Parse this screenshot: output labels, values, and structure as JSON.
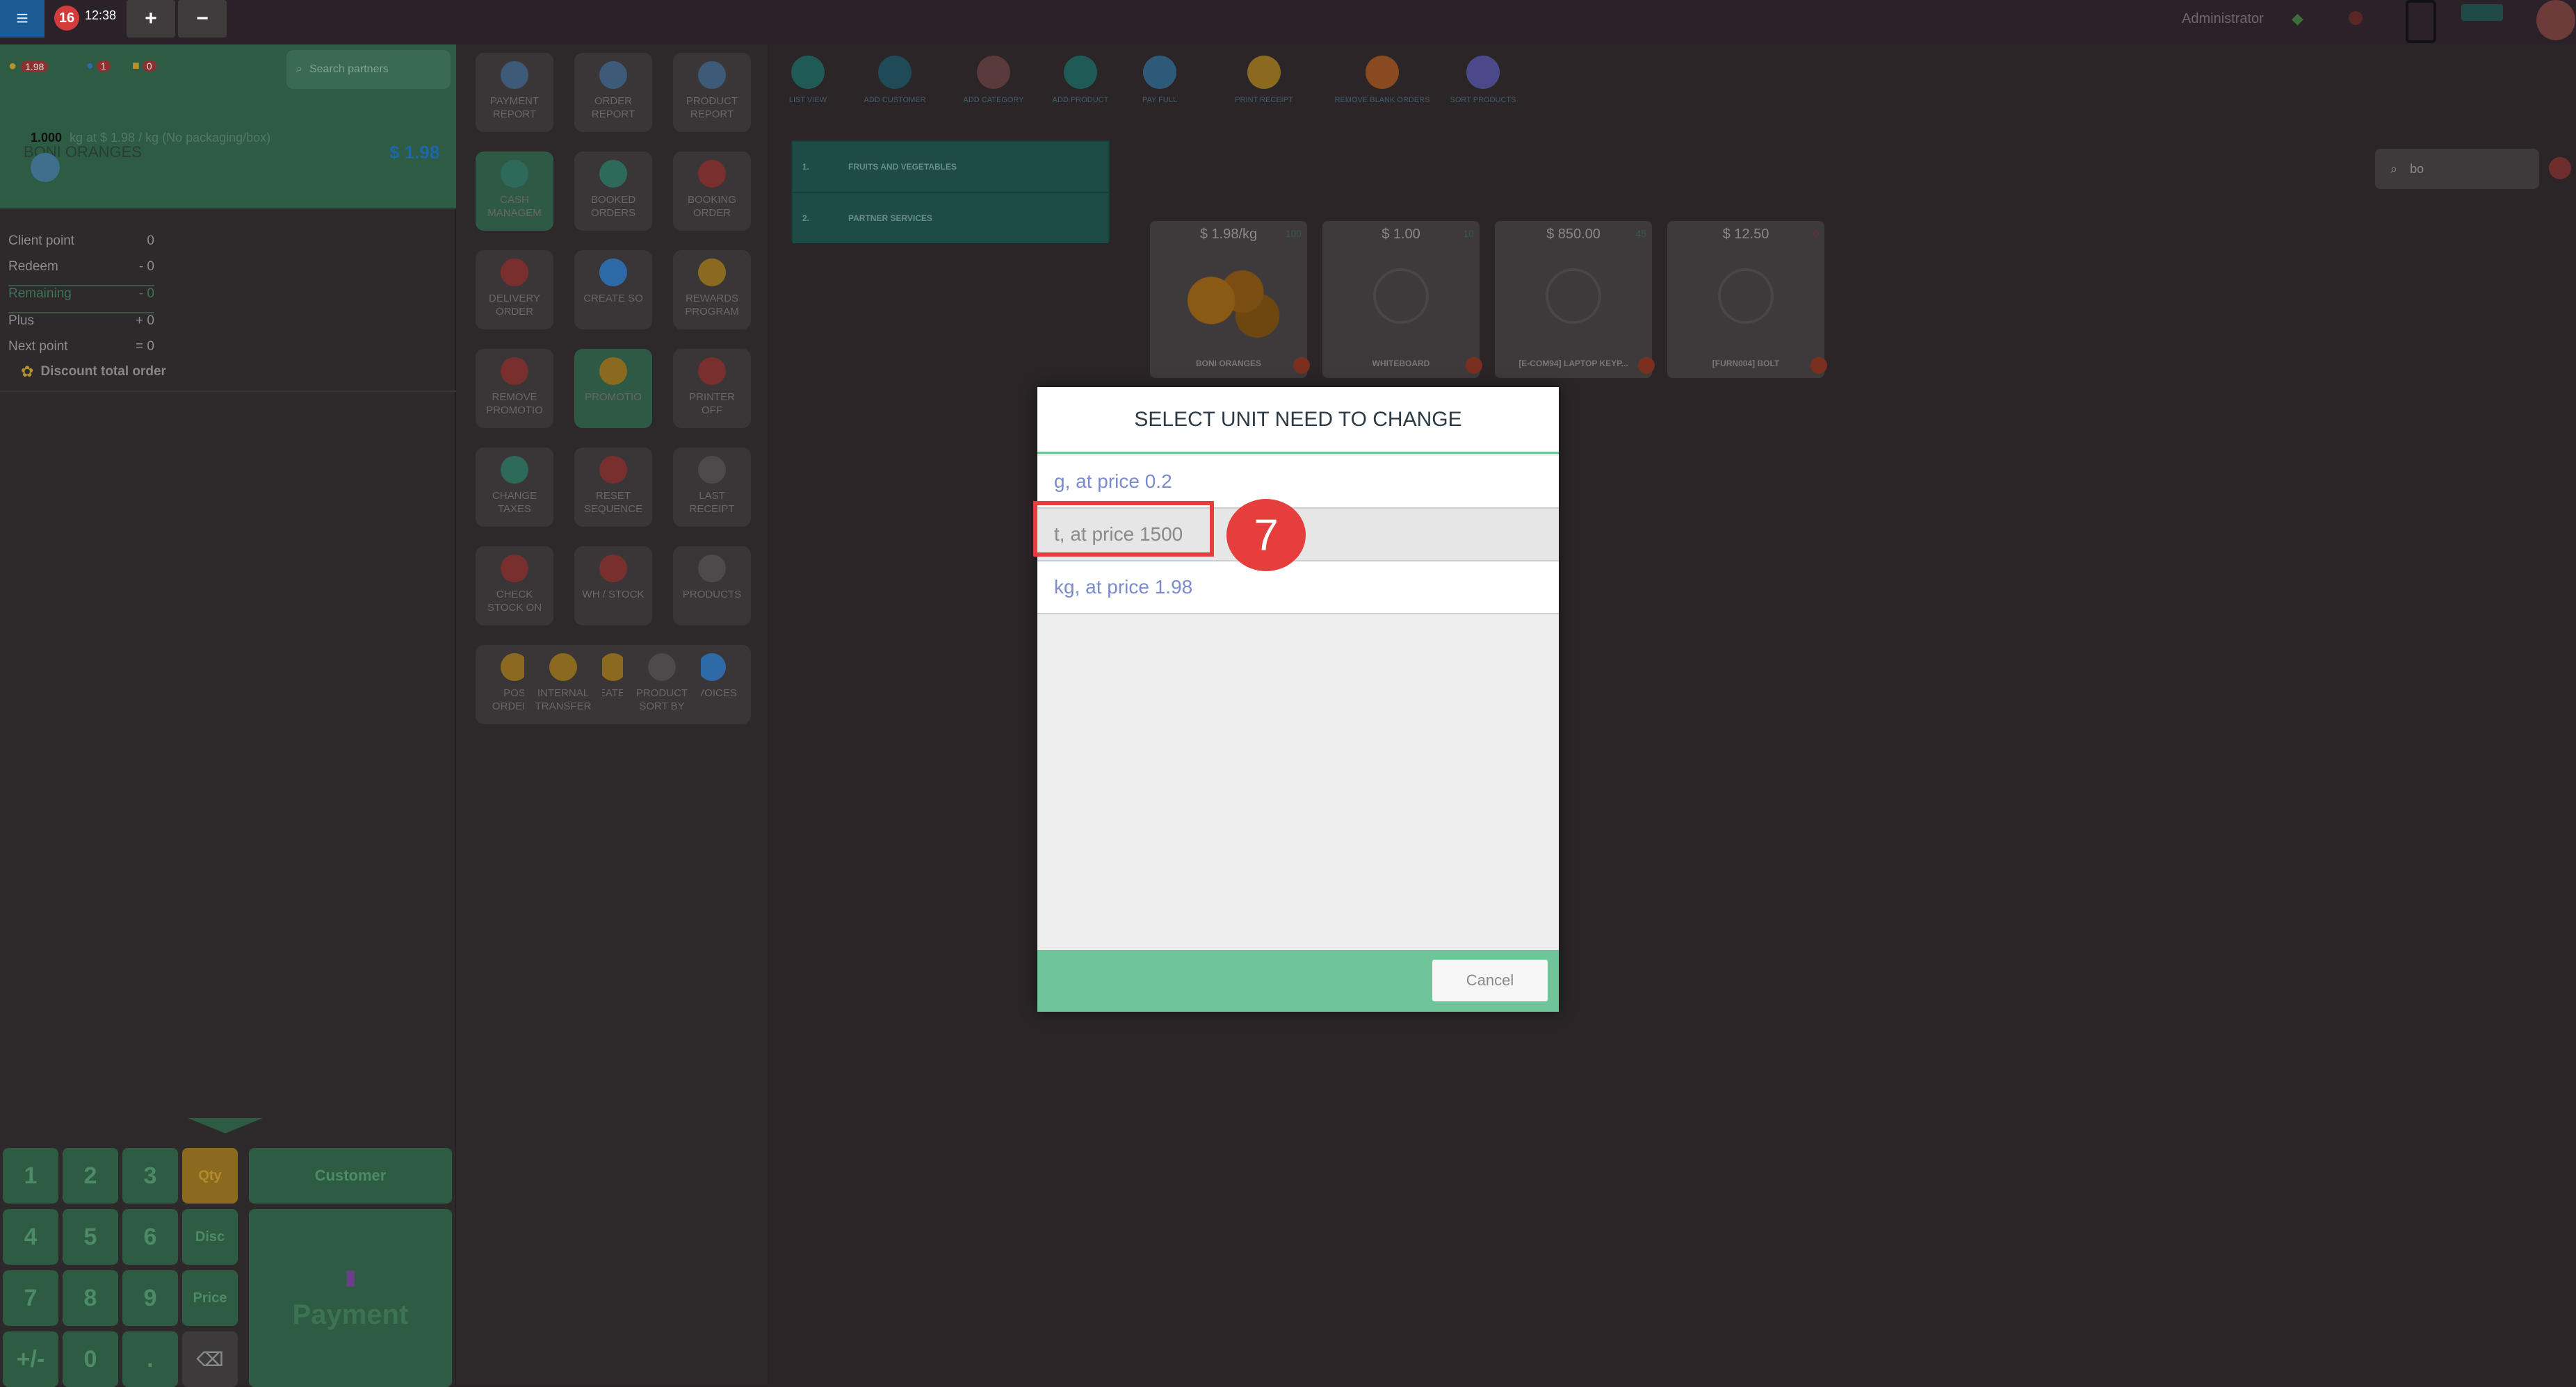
{
  "topbar": {
    "order_count": "16",
    "time": "12:38",
    "plus_label": "+",
    "minus_label": "−",
    "user": "Administrator"
  },
  "order": {
    "badge_amount": "1.98",
    "badge_count_1": "1",
    "badge_count_2": "0",
    "search_placeholder": "Search partners",
    "product_name": "BONI ORANGES",
    "product_total": "$ 1.98",
    "line_qty": "1.000",
    "line_detail": "kg at $ 1.98 / kg (No packaging/box)"
  },
  "points": {
    "rows": [
      {
        "label": "Client point",
        "value": "0"
      },
      {
        "label": "Redeem",
        "value": "- 0"
      },
      {
        "label": "Remaining",
        "value": "- 0"
      },
      {
        "label": "Plus",
        "value": "+ 0"
      },
      {
        "label": "Next point",
        "value": "= 0"
      }
    ],
    "discount_label": "Discount total order"
  },
  "numpad": {
    "keys": [
      "1",
      "2",
      "3",
      "Qty",
      "4",
      "5",
      "6",
      "Disc",
      "7",
      "8",
      "9",
      "Price",
      "+/-",
      "0",
      ".",
      "⌫"
    ],
    "customer_label": "Customer",
    "payment_label": "Payment"
  },
  "tools": [
    {
      "label": "Payment Report"
    },
    {
      "label": "Order Report"
    },
    {
      "label": "Product Report"
    },
    {
      "label": "Cash Managem"
    },
    {
      "label": "Booked Orders"
    },
    {
      "label": "Booking Order"
    },
    {
      "label": "Delivery Order"
    },
    {
      "label": "Create So"
    },
    {
      "label": "Rewards Program"
    },
    {
      "label": "Remove Promotio"
    },
    {
      "label": "Promotio"
    },
    {
      "label": "Printer Off"
    },
    {
      "label": "Change Taxes"
    },
    {
      "label": "Reset Sequence"
    },
    {
      "label": "Last Receipt"
    },
    {
      "label": "Check Stock On"
    },
    {
      "label": "WH / Stock"
    },
    {
      "label": "Products"
    },
    {
      "label": "POS Orders"
    },
    {
      "label": "Create PO"
    },
    {
      "label": "Invoices"
    },
    {
      "label": "Internal Transfer"
    },
    {
      "label": "Product Sort By"
    }
  ],
  "top_icons": [
    {
      "label": "List View"
    },
    {
      "label": "Add Customer"
    },
    {
      "label": "Add Category"
    },
    {
      "label": "Add Product"
    },
    {
      "label": "Pay Full"
    },
    {
      "label": "Print Receipt"
    },
    {
      "label": "Remove Blank Orders"
    },
    {
      "label": "Sort Products"
    }
  ],
  "categories": [
    {
      "num": "1.",
      "label": "Fruits and Vegetables"
    },
    {
      "num": "2.",
      "label": "Partner Services"
    }
  ],
  "product_search": {
    "value": "bo"
  },
  "products": [
    {
      "price": "$ 1.98/kg",
      "stock": "100",
      "name": "BONI ORANGES"
    },
    {
      "price": "$ 1.00",
      "stock": "10",
      "name": "WHITEBOARD"
    },
    {
      "price": "$ 850.00",
      "stock": "45",
      "name": "[E-COM94] LAPTOP KEYP..."
    },
    {
      "price": "$ 12.50",
      "stock": "0",
      "name": "[FURN004] BOLT"
    }
  ],
  "modal": {
    "title": "SELECT UNIT NEED TO CHANGE",
    "options": [
      {
        "label": "g, at price 0.2"
      },
      {
        "label": "t, at price 1500"
      },
      {
        "label": "kg, at price 1.98"
      }
    ],
    "cancel_label": "Cancel"
  },
  "annotation": {
    "step": "7"
  },
  "colors": {
    "accent_green": "#6fc49a",
    "highlight_red": "#e83d3d",
    "link_blue": "#7b8bd0"
  }
}
